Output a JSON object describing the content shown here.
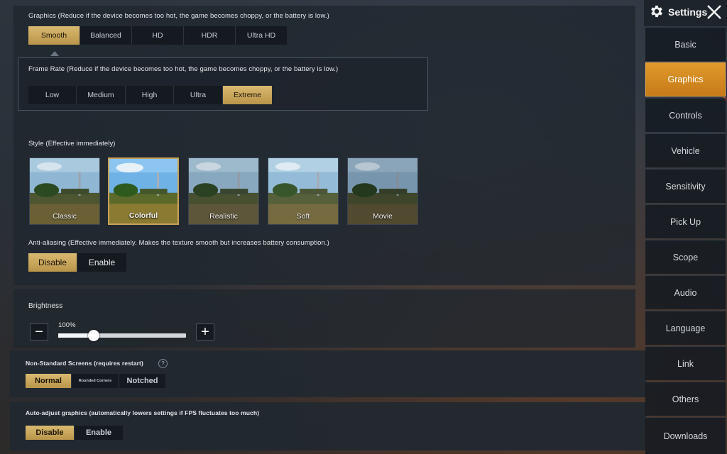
{
  "graphics": {
    "label": "Graphics (Reduce if the device becomes too hot, the game becomes choppy, or the battery is low.)",
    "options": [
      "Smooth",
      "Balanced",
      "HD",
      "HDR",
      "Ultra HD"
    ],
    "selected": "Smooth"
  },
  "frame_rate": {
    "label": "Frame Rate (Reduce if the device becomes too hot, the game becomes choppy, or the battery is low.)",
    "options": [
      "Low",
      "Medium",
      "High",
      "Ultra",
      "Extreme"
    ],
    "selected": "Extreme"
  },
  "style": {
    "label": "Style (Effective immediately)",
    "options": [
      "Classic",
      "Colorful",
      "Realistic",
      "Soft",
      "Movie"
    ],
    "selected": "Colorful"
  },
  "anti_aliasing": {
    "label": "Anti-aliasing (Effective immediately. Makes the texture smooth but increases battery consumption.)",
    "options": [
      "Disable",
      "Enable"
    ],
    "selected": "Disable"
  },
  "brightness": {
    "label": "Brightness",
    "value_text": "100%",
    "value": 0.28,
    "minus": "−",
    "plus": "+"
  },
  "non_standard": {
    "label": "Non-Standard Screens (requires restart)",
    "help": "?",
    "options": [
      "Normal",
      "Rounded Corners",
      "Notched"
    ],
    "selected": "Normal"
  },
  "auto_adjust": {
    "label": "Auto-adjust graphics (automatically lowers settings if FPS fluctuates too much)",
    "options": [
      "Disable",
      "Enable"
    ],
    "selected": "Disable"
  },
  "header": {
    "title": "Settings",
    "gear_icon": "gear-icon",
    "close_icon": "close-icon"
  },
  "sidebar": {
    "items": [
      "Basic",
      "Graphics",
      "Controls",
      "Vehicle",
      "Sensitivity",
      "Pick Up",
      "Scope",
      "Audio",
      "Language",
      "Link",
      "Others",
      "Downloads"
    ],
    "active": "Graphics"
  },
  "colors": {
    "accent_gold": "#c8a258",
    "accent_orange": "#d98a24"
  }
}
